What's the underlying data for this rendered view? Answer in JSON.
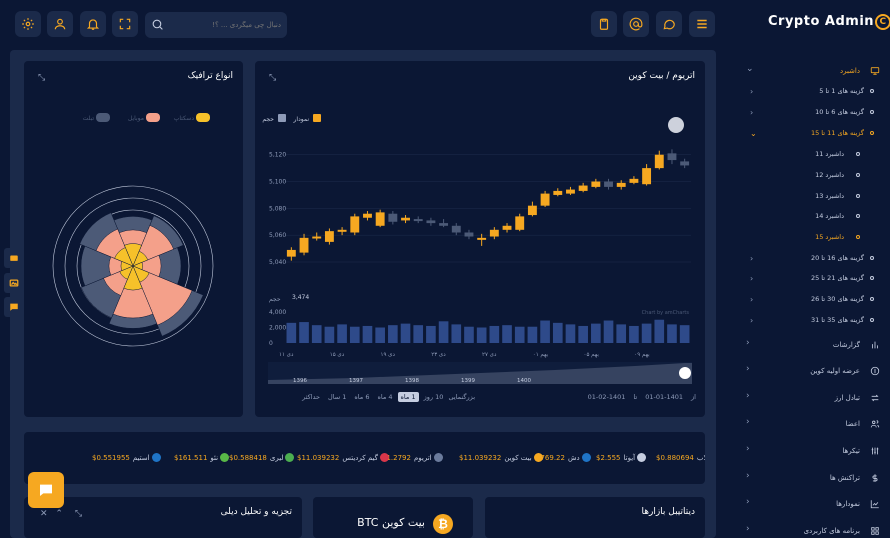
{
  "topbar": {
    "search_placeholder": "دنبال چی میگردی ... ؟!",
    "brand": "Crypto Admin",
    "brand_logo_letter": "C"
  },
  "sidebar": {
    "items": [
      {
        "label": "داشبرد",
        "active": true,
        "icon": "monitor-icon"
      },
      {
        "label": "گزارشات",
        "icon": "bar-chart-icon"
      },
      {
        "label": "عرضه اولیه کوین",
        "icon": "coin-icon"
      },
      {
        "label": "تبادل ارز",
        "icon": "exchange-icon"
      },
      {
        "label": "اعضا",
        "icon": "users-icon"
      },
      {
        "label": "تیکرها",
        "icon": "sliders-icon"
      },
      {
        "label": "تراکنش ها",
        "icon": "dollar-icon"
      },
      {
        "label": "نمودارها",
        "icon": "chart-icon"
      },
      {
        "label": "برنامه های کاربردی",
        "icon": "grid-icon"
      }
    ],
    "sub_items": [
      {
        "label": "گزینه های 1 تا 5"
      },
      {
        "label": "گزینه های 6 تا 10"
      },
      {
        "label": "گزینه های 11 تا 15",
        "active": true
      },
      {
        "label": "گزینه های 16 تا 20"
      },
      {
        "label": "گزینه های 21 تا 25"
      },
      {
        "label": "گزینه های 30 تا 26"
      },
      {
        "label": "گزینه های 35 تا 31"
      }
    ],
    "dashboards": [
      {
        "label": "داشبرد 11"
      },
      {
        "label": "داشبرد 12"
      },
      {
        "label": "داشبرد 13"
      },
      {
        "label": "داشبرد 14"
      },
      {
        "label": "داشبرد 15",
        "active": true
      }
    ]
  },
  "traffic_card": {
    "title": "انواع ترافیک",
    "legend": [
      {
        "label": "دسکتاپ",
        "color": "#f6c12a"
      },
      {
        "label": "موبایل",
        "color": "#f4a08a"
      },
      {
        "label": "تبلت",
        "color": "#4c5a77"
      }
    ]
  },
  "eth_card": {
    "title": "اتریوم / بیت کوین",
    "legend": [
      {
        "label": "نمودار",
        "color": "#f6a821"
      },
      {
        "label": "حجم",
        "color": "#8e9bb8"
      }
    ],
    "volume_label": "حجم",
    "volume_value": "3,474",
    "x_ticks": [
      "دی ۱۱",
      "دی ۱۵",
      "دی ۱۹",
      "دی ۲۳",
      "دی ۲۷",
      "بهم ۰۱",
      "بهم ۰۵",
      "بهم ۰۹"
    ],
    "nav_years": [
      "1396",
      "1397",
      "1398",
      "1399",
      "1400"
    ],
    "zoom_label": "بزرگنمایی",
    "zoom_options": [
      "10 روز",
      "1 ماه",
      "4 ماه",
      "6 ماه",
      "1 سال",
      "حداکثر"
    ],
    "zoom_active": "1 ماه",
    "date_from_label": "از",
    "date_from": "1401-01-01",
    "date_to_label": "تا",
    "date_to": "1401-02-01",
    "watermark": "Chart by amCharts"
  },
  "chart_data": {
    "type": "candlestick",
    "y_ticks": [
      "5,120",
      "5,100",
      "5,080",
      "5,060",
      "5,040"
    ],
    "volume_ticks": [
      "4,000",
      "2,000",
      "0"
    ],
    "candles": [
      {
        "o": 5044,
        "c": 5049,
        "h": 5051,
        "l": 5041
      },
      {
        "o": 5047,
        "c": 5058,
        "h": 5061,
        "l": 5045
      },
      {
        "o": 5058,
        "c": 5059,
        "h": 5062,
        "l": 5056
      },
      {
        "o": 5055,
        "c": 5063,
        "h": 5065,
        "l": 5053
      },
      {
        "o": 5063,
        "c": 5064,
        "h": 5066,
        "l": 5060
      },
      {
        "o": 5062,
        "c": 5074,
        "h": 5076,
        "l": 5060
      },
      {
        "o": 5073,
        "c": 5076,
        "h": 5078,
        "l": 5071
      },
      {
        "o": 5067,
        "c": 5077,
        "h": 5079,
        "l": 5066
      },
      {
        "o": 5076,
        "c": 5070,
        "h": 5078,
        "l": 5068
      },
      {
        "o": 5071,
        "c": 5073,
        "h": 5075,
        "l": 5069
      },
      {
        "o": 5072,
        "c": 5071,
        "h": 5074,
        "l": 5069
      },
      {
        "o": 5071,
        "c": 5069,
        "h": 5073,
        "l": 5067
      },
      {
        "o": 5069,
        "c": 5067,
        "h": 5072,
        "l": 5066
      },
      {
        "o": 5067,
        "c": 5062,
        "h": 5069,
        "l": 5060
      },
      {
        "o": 5062,
        "c": 5059,
        "h": 5064,
        "l": 5057
      },
      {
        "o": 5057,
        "c": 5058,
        "h": 5061,
        "l": 5052
      },
      {
        "o": 5059,
        "c": 5064,
        "h": 5066,
        "l": 5057
      },
      {
        "o": 5064,
        "c": 5067,
        "h": 5069,
        "l": 5062
      },
      {
        "o": 5064,
        "c": 5074,
        "h": 5076,
        "l": 5063
      },
      {
        "o": 5075,
        "c": 5082,
        "h": 5085,
        "l": 5074
      },
      {
        "o": 5082,
        "c": 5091,
        "h": 5093,
        "l": 5081
      },
      {
        "o": 5090,
        "c": 5093,
        "h": 5095,
        "l": 5089
      },
      {
        "o": 5091,
        "c": 5094,
        "h": 5096,
        "l": 5090
      },
      {
        "o": 5093,
        "c": 5097,
        "h": 5099,
        "l": 5092
      },
      {
        "o": 5096,
        "c": 5100,
        "h": 5102,
        "l": 5095
      },
      {
        "o": 5100,
        "c": 5096,
        "h": 5102,
        "l": 5094
      },
      {
        "o": 5096,
        "c": 5099,
        "h": 5101,
        "l": 5094
      },
      {
        "o": 5099,
        "c": 5102,
        "h": 5104,
        "l": 5098
      },
      {
        "o": 5098,
        "c": 5110,
        "h": 5113,
        "l": 5097
      },
      {
        "o": 5110,
        "c": 5120,
        "h": 5123,
        "l": 5109
      },
      {
        "o": 5121,
        "c": 5116,
        "h": 5124,
        "l": 5113
      },
      {
        "o": 5115,
        "c": 5112,
        "h": 5117,
        "l": 5110
      }
    ],
    "volumes": [
      2600,
      2700,
      2300,
      2100,
      2400,
      2100,
      2200,
      2000,
      2300,
      2500,
      2300,
      2200,
      2800,
      2400,
      2100,
      2000,
      2200,
      2300,
      2100,
      2100,
      2900,
      2600,
      2400,
      2200,
      2500,
      2900,
      2400,
      2200,
      2500,
      3000,
      2400,
      2300
    ],
    "polar_segments": [
      {
        "angle": 0,
        "desktop": 0.28,
        "mobile": 0.45,
        "tablet": 0.62
      },
      {
        "angle": 45,
        "desktop": 0.2,
        "mobile": 0.55,
        "tablet": 0.68
      },
      {
        "angle": 90,
        "desktop": 0.12,
        "mobile": 0.35,
        "tablet": 0.6
      },
      {
        "angle": 135,
        "desktop": 0.22,
        "mobile": 0.8,
        "tablet": 0.95
      },
      {
        "angle": 180,
        "desktop": 0.3,
        "mobile": 0.65,
        "tablet": 0.78
      },
      {
        "angle": 225,
        "desktop": 0.18,
        "mobile": 0.4,
        "tablet": 0.7
      },
      {
        "angle": 270,
        "desktop": 0.15,
        "mobile": 0.3,
        "tablet": 0.65
      },
      {
        "angle": 315,
        "desktop": 0.25,
        "mobile": 0.5,
        "tablet": 0.72
      }
    ]
  },
  "ticker": [
    {
      "name": "کلاب",
      "price": "$0.880694",
      "color": "#c5cde0"
    },
    {
      "name": "آیوتا",
      "price": "$2.555",
      "color": "#c5cde0"
    },
    {
      "name": "دش",
      "price": "$769.22",
      "color": "#1f74c6"
    },
    {
      "name": "بیت کوین",
      "price": "$11.039232",
      "color": "#f6a821"
    },
    {
      "name": "اتریوم",
      "price": "$1.2792",
      "color": "#6b7b9c"
    },
    {
      "name": "گیم کردیتس",
      "price": "$11.039232",
      "color": "#d9364a"
    },
    {
      "name": "لیری",
      "price": "$0.588418",
      "color": "#4caf50"
    },
    {
      "name": "نئو",
      "price": "$161.511",
      "color": "#58b847"
    },
    {
      "name": "استیم",
      "price": "$0.551955",
      "color": "#1f74c6"
    }
  ],
  "bottom_cards": {
    "analysis_title": "تجزیه و تحلیل دیلی",
    "btc_title": "بیت کوین BTC",
    "markets_title": "دیتاتیبل بازارها"
  }
}
